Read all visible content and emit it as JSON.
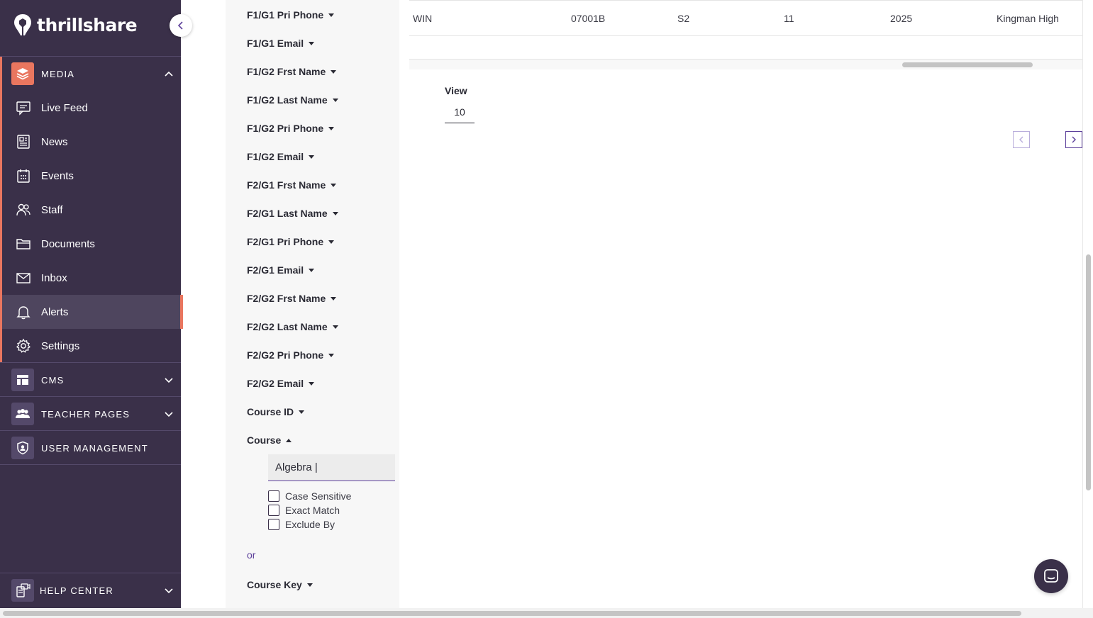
{
  "brand": {
    "name": "thrillshare"
  },
  "sidebar": {
    "media": {
      "label": "MEDIA",
      "accent": "#e9765f"
    },
    "items": [
      {
        "label": "Live Feed",
        "icon": "chat-box-icon"
      },
      {
        "label": "News",
        "icon": "newspaper-icon"
      },
      {
        "label": "Events",
        "icon": "calendar-icon"
      },
      {
        "label": "Staff",
        "icon": "people-icon"
      },
      {
        "label": "Documents",
        "icon": "folder-icon"
      },
      {
        "label": "Inbox",
        "icon": "envelope-icon"
      },
      {
        "label": "Alerts",
        "icon": "bell-icon",
        "active": true
      },
      {
        "label": "Settings",
        "icon": "gear-icon"
      }
    ],
    "cms": {
      "label": "CMS"
    },
    "teacher_pages": {
      "label": "TEACHER PAGES"
    },
    "user_management": {
      "label": "USER MANAGEMENT"
    },
    "help_center": {
      "label": "HELP CENTER"
    }
  },
  "filters": {
    "fields": [
      "F1/G1 Pri Phone",
      "F1/G1 Email",
      "F1/G2 Frst Name",
      "F1/G2 Last Name",
      "F1/G2 Pri Phone",
      "F1/G2 Email",
      "F2/G1 Frst Name",
      "F2/G1 Last Name",
      "F2/G1 Pri Phone",
      "F2/G1 Email",
      "F2/G2 Frst Name",
      "F2/G2 Last Name",
      "F2/G2 Pri Phone",
      "F2/G2 Email",
      "Course ID"
    ],
    "course": {
      "label": "Course",
      "value": "Algebra |",
      "options": [
        "Case Sensitive",
        "Exact Match",
        "Exclude By"
      ]
    },
    "or_label": "or",
    "course_key": "Course Key"
  },
  "table": {
    "row": [
      "WIN",
      "07001B",
      "S2",
      "11",
      "2025",
      "Kingman High"
    ]
  },
  "pagination": {
    "view_label": "View",
    "view_value": "10"
  }
}
